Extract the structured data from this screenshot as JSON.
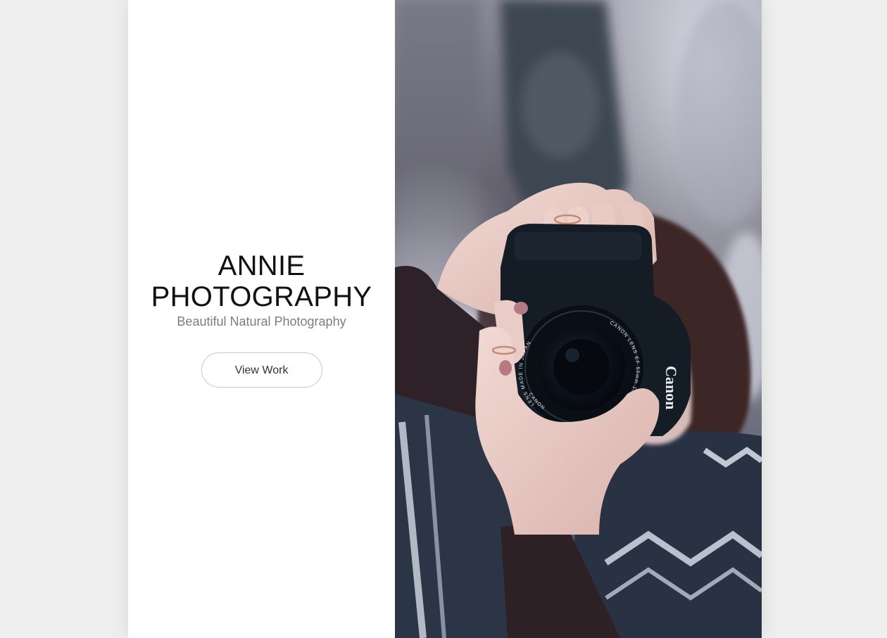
{
  "hero": {
    "title_line1": "ANNIE",
    "title_line2": "PHOTOGRAPHY",
    "tagline": "Beautiful Natural Photography",
    "cta_label": "View Work"
  },
  "photo": {
    "camera_brand": "Canon",
    "lens_text_left": "LENS MADE IN JAPAN",
    "lens_text_right": "CANON LENS EF 50mm 1:1.4",
    "lens_text_bottom": "CANON"
  },
  "colors": {
    "page_background": "#efefef",
    "panel_background": "#ffffff",
    "title_text": "#111111",
    "tagline_text": "#7d7d7d",
    "button_border": "#c9c9c9"
  }
}
